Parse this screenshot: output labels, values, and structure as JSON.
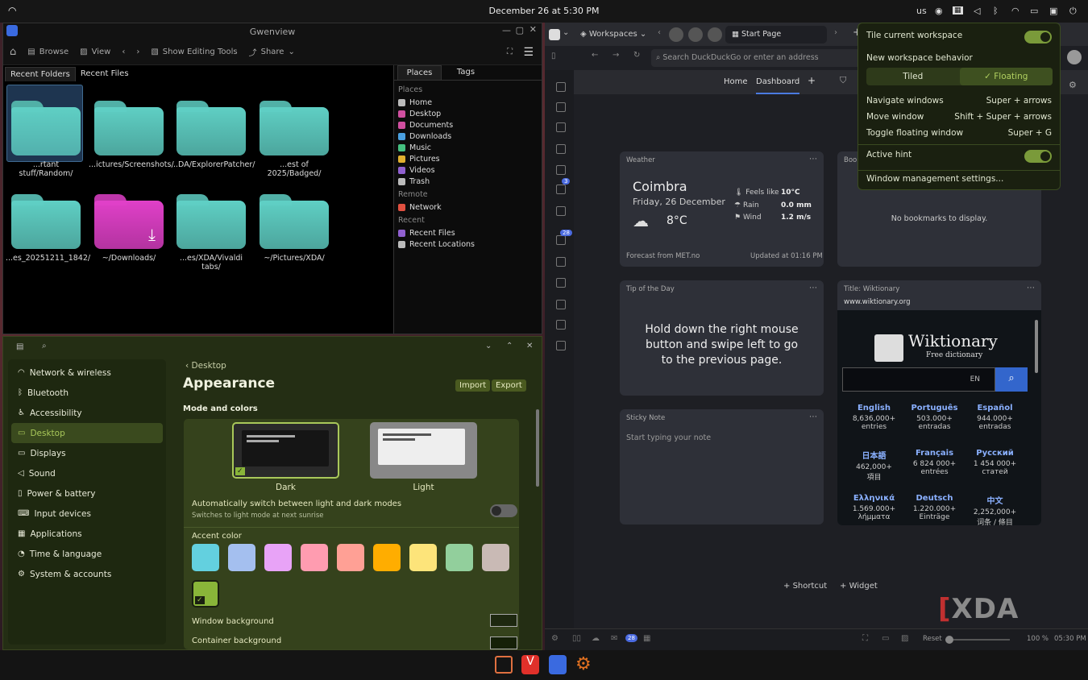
{
  "topbar": {
    "datetime": "December 26 at 5:30 PM",
    "kbd_layout": "us"
  },
  "gwenview": {
    "title": "Gwenview",
    "toolbar": {
      "browse": "Browse",
      "view": "View",
      "editing": "Show Editing Tools",
      "share": "Share"
    },
    "tabs": [
      "Recent Folders",
      "Recent Files"
    ],
    "folders": [
      {
        "label": "...rtant stuff/Random/",
        "color": "#5fcfc4"
      },
      {
        "label": "...ictures/Screenshots/",
        "color": "#5fcfc4"
      },
      {
        "label": "...DA/ExplorerPatcher/",
        "color": "#5fcfc4"
      },
      {
        "label": "...est of 2025/Badged/",
        "color": "#5fcfc4"
      },
      {
        "label": "...es_20251211_1842/",
        "color": "#5fcfc4"
      },
      {
        "label": "~/Downloads/",
        "color": "#e040c8"
      },
      {
        "label": "...es/XDA/Vivaldi tabs/",
        "color": "#5fcfc4"
      },
      {
        "label": "~/Pictures/XDA/",
        "color": "#5fcfc4"
      }
    ],
    "side_tabs": [
      "Places",
      "Tags"
    ],
    "places_head": "Places",
    "places": [
      {
        "label": "Home",
        "color": "#bbbbbb"
      },
      {
        "label": "Desktop",
        "color": "#d04fa0"
      },
      {
        "label": "Documents",
        "color": "#d04fa0"
      },
      {
        "label": "Downloads",
        "color": "#4aa0e0"
      },
      {
        "label": "Music",
        "color": "#45c080"
      },
      {
        "label": "Pictures",
        "color": "#e0b030"
      },
      {
        "label": "Videos",
        "color": "#9060d0"
      },
      {
        "label": "Trash",
        "color": "#bbbbbb"
      }
    ],
    "remote_head": "Remote",
    "remote": [
      {
        "label": "Network",
        "color": "#e05040"
      }
    ],
    "recent_head": "Recent",
    "recent": [
      {
        "label": "Recent Files",
        "color": "#9060d0"
      },
      {
        "label": "Recent Locations",
        "color": "#bbbbbb"
      }
    ]
  },
  "settings": {
    "sidebar": [
      "Network & wireless",
      "Bluetooth",
      "Accessibility",
      "Desktop",
      "Displays",
      "Sound",
      "Power & battery",
      "Input devices",
      "Applications",
      "Time & language",
      "System & accounts"
    ],
    "breadcrumb": "Desktop",
    "title": "Appearance",
    "import": "Import",
    "export": "Export",
    "section": "Mode and colors",
    "mode_dark": "Dark",
    "mode_light": "Light",
    "auto_switch": "Automatically switch between light and dark modes",
    "auto_switch_sub": "Switches to light mode at next sunrise",
    "accent_label": "Accent color",
    "accents": [
      "#63d0df",
      "#a4bfef",
      "#e8a3f7",
      "#ff9cb0",
      "#ffa095",
      "#ffad00",
      "#fde47a",
      "#92cf9c",
      "#c9bab5",
      "#89b539"
    ],
    "window_bg": "Window background",
    "container_bg": "Container background"
  },
  "vivaldi": {
    "workspaces": "Workspaces",
    "tab": "Start Page",
    "address_placeholder": "Search DuckDuckGo or enter an address",
    "nav": {
      "home": "Home",
      "dashboard": "Dashboard"
    },
    "badges": {
      "mail": "3",
      "feeds": "28",
      "status": "28"
    },
    "weather": {
      "title": "Weather",
      "city": "Coimbra",
      "date": "Friday, 26 December",
      "temp": "8°C",
      "feels_label": "Feels like",
      "feels": "10°C",
      "rain_label": "Rain",
      "rain": "0.0 mm",
      "wind_label": "Wind",
      "wind": "1.2 m/s",
      "source": "Forecast from MET.no",
      "updated": "Updated at 01:16 PM"
    },
    "bookmarks": {
      "title": "Book",
      "empty": "No bookmarks to display."
    },
    "tip": {
      "title": "Tip of the Day",
      "text": "Hold down the right mouse button and swipe left to go to the previous page."
    },
    "wikt": {
      "title": "Title: Wiktionary",
      "url": "www.wiktionary.org",
      "name": "Wiktionary",
      "sub": "Free dictionary",
      "lang": "EN",
      "langs": [
        [
          "English",
          "8,636,000+",
          "entries"
        ],
        [
          "Português",
          "503.000+",
          "entradas"
        ],
        [
          "Español",
          "944.000+",
          "entradas"
        ],
        [
          "日本語",
          "462,000+",
          "項目"
        ],
        [
          "Français",
          "6 824 000+",
          "entrées"
        ],
        [
          "Русский",
          "1 454 000+",
          "статей"
        ],
        [
          "Ελληνικά",
          "1.569.000+",
          "λήμματα"
        ],
        [
          "Deutsch",
          "1.220.000+",
          "Einträge"
        ],
        [
          "中文",
          "2,252,000+",
          "词条 / 條目"
        ]
      ]
    },
    "sticky": {
      "title": "Sticky Note",
      "placeholder": "Start typing your note"
    },
    "shortcut": "Shortcut",
    "widget": "Widget",
    "status": {
      "reset": "Reset",
      "zoom": "100 %",
      "time": "05:30 PM"
    },
    "watermark": "XDA"
  },
  "popup": {
    "tile": "Tile current workspace",
    "new_ws": "New workspace behavior",
    "tiled": "Tiled",
    "floating": "Floating",
    "rows": [
      [
        "Navigate windows",
        "Super + arrows"
      ],
      [
        "Move window",
        "Shift + Super + arrows"
      ],
      [
        "Toggle floating window",
        "Super + G"
      ]
    ],
    "active_hint": "Active hint",
    "settings": "Window management settings..."
  }
}
